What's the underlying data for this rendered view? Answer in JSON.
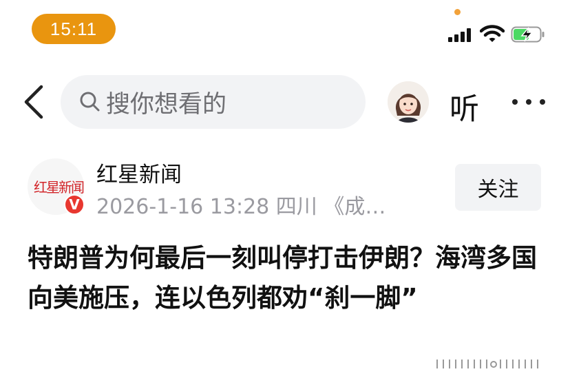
{
  "status_bar": {
    "time": "15:11",
    "accent_color": "#e9950f",
    "icons": [
      "signal-icon",
      "wifi-icon",
      "battery-charging-icon"
    ]
  },
  "nav": {
    "search_placeholder": "搜你想看的",
    "listen_label": "听",
    "icons": [
      "back-icon",
      "search-icon",
      "avatar",
      "more-icon"
    ]
  },
  "author": {
    "logo_text": "红星新闻",
    "name": "红星新闻",
    "meta": "2026-1-16 13:28 四川 《成…",
    "verified_badge": "V",
    "follow_label": "关注",
    "badge_color": "#e8372f"
  },
  "article": {
    "headline": "特朗普为何最后一刻叫停打击伊朗？海湾多国向美施压，连以色列都劝“刹一脚”"
  }
}
